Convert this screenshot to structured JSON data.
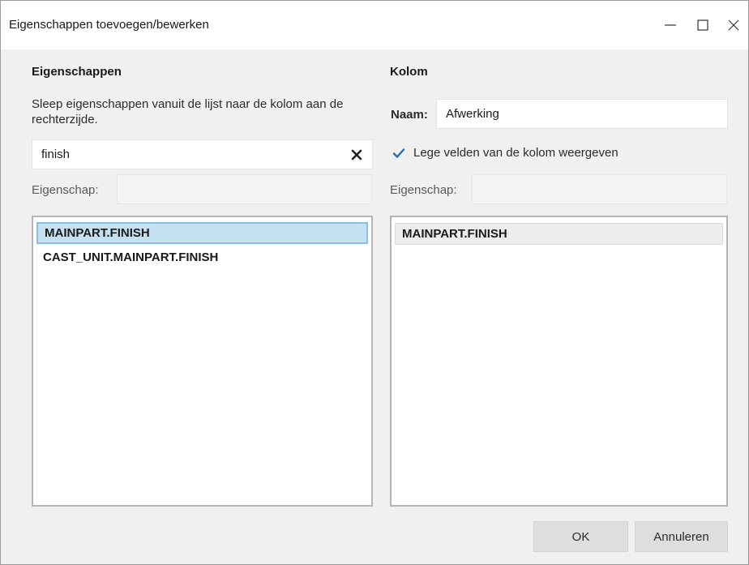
{
  "window": {
    "title": "Eigenschappen toevoegen/bewerken"
  },
  "left": {
    "section_title": "Eigenschappen",
    "description": "Sleep eigenschappen vanuit de lijst naar de kolom aan de rechterzijde.",
    "search_value": "finish",
    "property_label": "Eigenschap:",
    "property_value": "",
    "items": [
      {
        "label": "MAINPART.FINISH",
        "selected": true
      },
      {
        "label": "CAST_UNIT.MAINPART.FINISH",
        "selected": false
      }
    ]
  },
  "right": {
    "section_title": "Kolom",
    "name_label": "Naam:",
    "name_value": "Afwerking",
    "show_empty_label": "Lege velden van de kolom weergeven",
    "show_empty_checked": true,
    "property_label": "Eigenschap:",
    "property_value": "",
    "items": [
      {
        "label": "MAINPART.FINISH"
      }
    ]
  },
  "footer": {
    "ok_label": "OK",
    "cancel_label": "Annuleren"
  },
  "icons": {
    "minimize": "minimize-icon",
    "maximize": "maximize-icon",
    "close": "close-icon",
    "clear": "clear-icon",
    "checkmark": "checkmark-icon"
  },
  "colors": {
    "accent": "#1e6fb8",
    "selection": "#c5e1f1"
  }
}
